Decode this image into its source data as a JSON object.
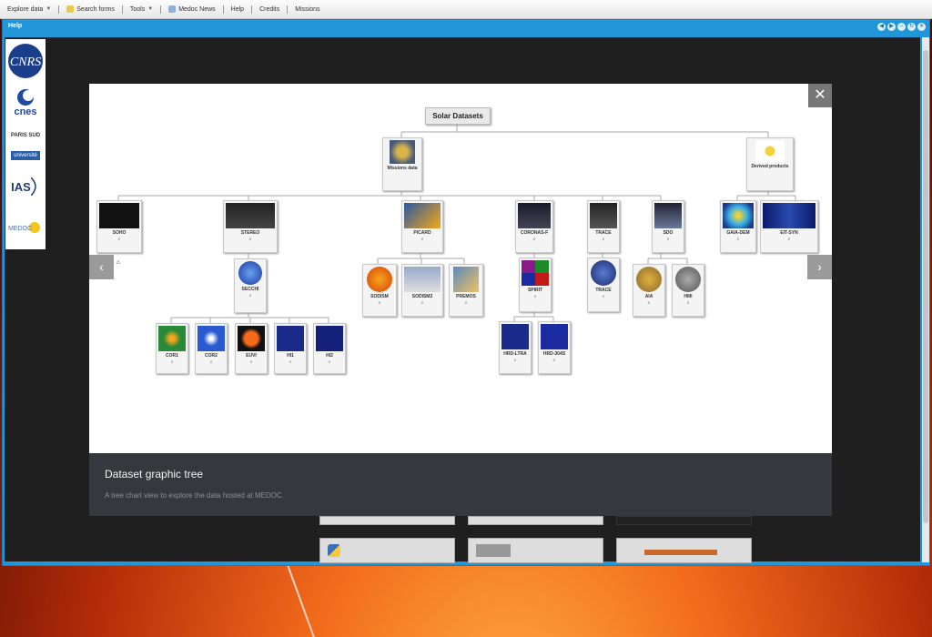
{
  "menu": {
    "items": [
      {
        "label": "Explore data",
        "caret": true,
        "icon": null
      },
      {
        "label": "Search forms",
        "caret": false,
        "icon": "search-forms-icon"
      },
      {
        "label": "Tools",
        "caret": true,
        "icon": null
      },
      {
        "label": "Medoc News",
        "caret": false,
        "icon": "news-icon"
      },
      {
        "label": "Help",
        "caret": false,
        "icon": null
      },
      {
        "label": "Credits",
        "caret": false,
        "icon": null
      },
      {
        "label": "Missions",
        "caret": false,
        "icon": null
      }
    ]
  },
  "window": {
    "title": "Help"
  },
  "logos": {
    "cnrs": "CNRS",
    "cnes": "cnes",
    "paris": "PARIS SUD",
    "universite": "université",
    "ias": "IAS",
    "medoc": "MEDOC"
  },
  "lightbox": {
    "title": "Dataset graphic tree",
    "description": "A tree chart view to explore the data hosted at MEDOC.",
    "close": "✕",
    "prev": "‹",
    "next": "›"
  },
  "tree": {
    "root": "Solar Datasets",
    "level1": {
      "missions": "Missions data",
      "derived": "Derived products"
    },
    "missions": [
      "SOHO",
      "STEREO",
      "PICARD",
      "CORONAS-F",
      "TRACE",
      "SDO"
    ],
    "derived": [
      "GAIA-DEM",
      "EIT-SYN"
    ],
    "stereo_child": "SECCHI",
    "secchi_children": [
      "COR1",
      "COR2",
      "EUVI",
      "HI1",
      "HI2"
    ],
    "picard_children": [
      "SODISM",
      "SODISM2",
      "PREMOS"
    ],
    "coronas_child": "SPIRIT",
    "spirit_children": [
      "HRD-LTRA",
      "HRD-304S"
    ],
    "trace_child": "TRACE",
    "sdo_children": [
      "AIA",
      "HMI"
    ]
  },
  "colors": {
    "window_blue": "#2196d9",
    "caption_bg": "#35393e"
  }
}
